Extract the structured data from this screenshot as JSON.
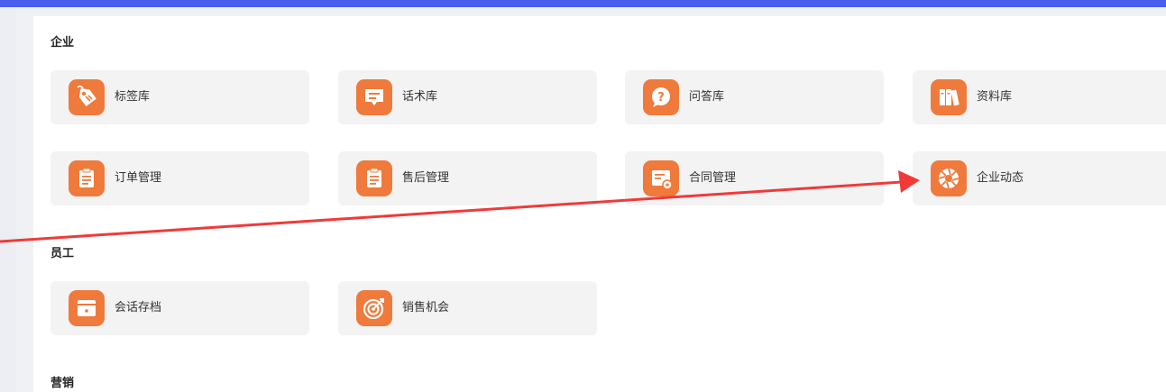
{
  "colors": {
    "top_bar": "#4a5ef0",
    "icon_bg": "#ef7a3b",
    "card_bg": "#f3f3f4",
    "annotation_arrow": "#f03a3a"
  },
  "sections": {
    "enterprise": {
      "title": "企业",
      "items": [
        {
          "label": "标签库",
          "icon": "tag-icon"
        },
        {
          "label": "话术库",
          "icon": "chat-bubble-icon"
        },
        {
          "label": "问答库",
          "icon": "question-icon"
        },
        {
          "label": "资料库",
          "icon": "books-icon"
        },
        {
          "label": "订单管理",
          "icon": "clipboard-icon"
        },
        {
          "label": "售后管理",
          "icon": "clipboard-icon"
        },
        {
          "label": "合同管理",
          "icon": "contract-icon"
        },
        {
          "label": "企业动态",
          "icon": "aperture-icon"
        }
      ]
    },
    "employee": {
      "title": "员工",
      "items": [
        {
          "label": "会话存档",
          "icon": "archive-box-icon"
        },
        {
          "label": "销售机会",
          "icon": "target-icon"
        }
      ]
    },
    "marketing": {
      "title": "营销"
    }
  }
}
